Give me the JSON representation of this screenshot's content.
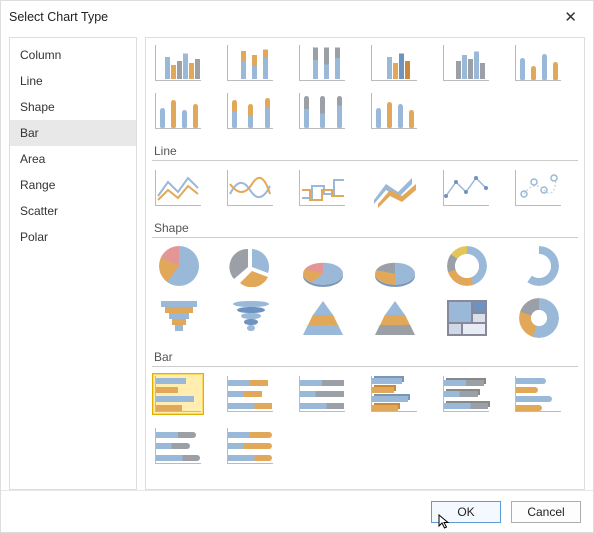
{
  "window": {
    "title": "Select Chart Type"
  },
  "sidebar": {
    "items": [
      {
        "label": "Column"
      },
      {
        "label": "Line"
      },
      {
        "label": "Shape"
      },
      {
        "label": "Bar"
      },
      {
        "label": "Area"
      },
      {
        "label": "Range"
      },
      {
        "label": "Scatter"
      },
      {
        "label": "Polar"
      }
    ],
    "selected_index": 3
  },
  "sections": {
    "line_label": "Line",
    "shape_label": "Shape",
    "bar_label": "Bar"
  },
  "buttons": {
    "ok": "OK",
    "cancel": "Cancel"
  },
  "selection": {
    "selected_thumb": "bar-clustered-2d"
  }
}
